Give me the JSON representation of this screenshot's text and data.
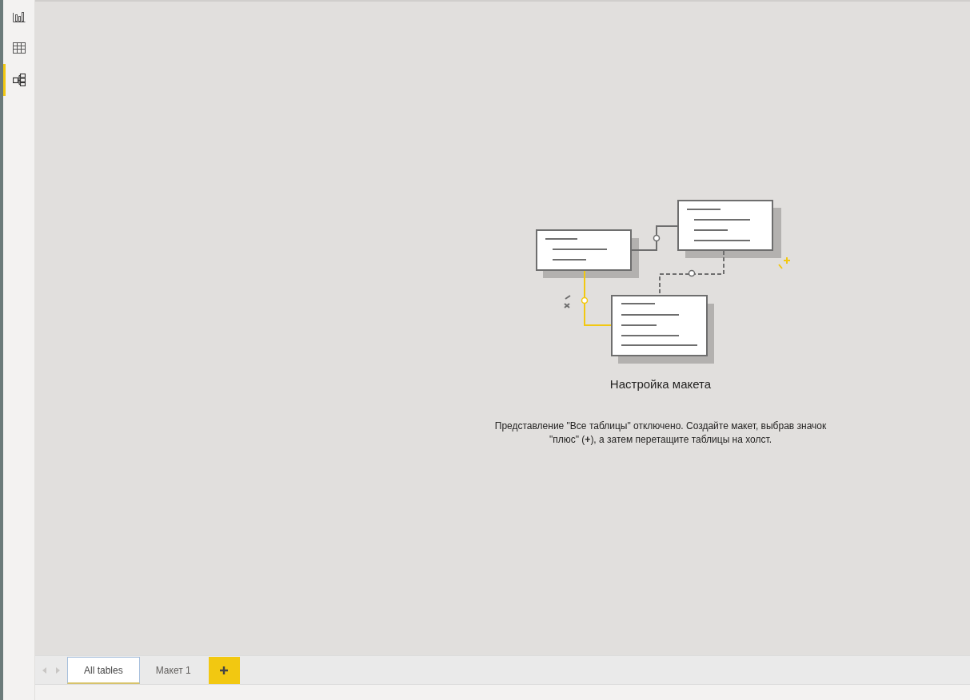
{
  "sidebar": {
    "items": [
      {
        "kind": "report",
        "selected": false
      },
      {
        "kind": "data",
        "selected": false
      },
      {
        "kind": "model",
        "selected": true
      }
    ]
  },
  "empty_state": {
    "title": "Настройка макета",
    "message": "Представление \"Все таблицы\" отключено. Создайте макет, выбрав значок \"плюс\" (**+**), а затем перетащите таблицы на холст."
  },
  "tabs": [
    {
      "label": "All tables",
      "selected": true
    },
    {
      "label": "Макет 1",
      "selected": false
    }
  ]
}
